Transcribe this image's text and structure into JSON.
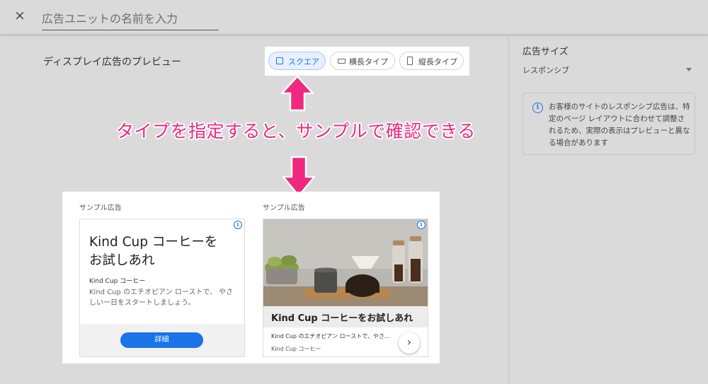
{
  "header": {
    "close_icon": "×",
    "name_placeholder": "広告ユニットの名前を入力"
  },
  "preview": {
    "title": "ディスプレイ広告のプレビュー",
    "types": [
      {
        "label": "スクエア",
        "active": true
      },
      {
        "label": "横長タイプ",
        "active": false
      },
      {
        "label": "縦長タイプ",
        "active": false
      }
    ]
  },
  "annotation": {
    "text": "タイプを指定すると、サンプルで確認できる",
    "color": "#f0287f"
  },
  "samples": {
    "left": {
      "label": "サンプル広告",
      "headline": "Kind Cup コーヒーを お試しあれ",
      "advertiser": "Kind Cup コーヒー",
      "description": "Kind Cup のエチオピアン ローストで、 やさしい一日をスタートしましょう。",
      "cta": "詳細"
    },
    "right": {
      "label": "サンプル広告",
      "headline": "Kind Cup コーヒーをお試しあれ",
      "description": "Kind Cup のエチオピアン ローストで、やさ...",
      "advertiser": "Kind Cup コーヒー",
      "next_icon": "›"
    },
    "adchoices_icon": "i"
  },
  "sidebar": {
    "size_title": "広告サイズ",
    "size_value": "レスポンシブ",
    "info_icon": "i",
    "info_text": "お客様のサイトのレスポンシブ広告は、特定のページ レイアウトに合わせて調整されるため、実際の表示はプレビューと異なる場合があります"
  },
  "colors": {
    "accent": "#1a73e8",
    "annotation": "#f0287f",
    "background": "#dadada"
  }
}
